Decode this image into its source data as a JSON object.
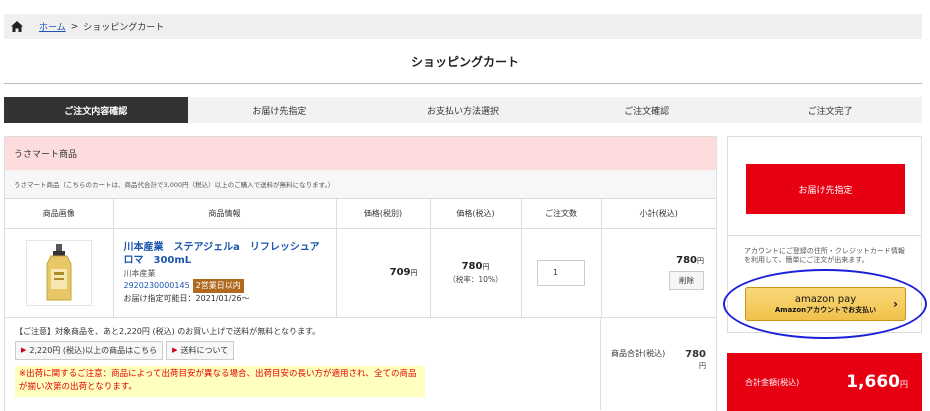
{
  "breadcrumb": {
    "home": "ホーム",
    "separator": ">",
    "current": "ショッピングカート"
  },
  "page": {
    "title": "ショッピングカート"
  },
  "steps": [
    "ご注文内容確認",
    "お届け先指定",
    "お支払い方法選択",
    "ご注文確認",
    "ご注文完了"
  ],
  "store": {
    "name": "うさマート商品",
    "note": "うさマート商品（こちらのカートは、商品代合計で3,000円（税込）以上のご購入で送料が無料になります。）"
  },
  "table": {
    "headers": [
      "商品画像",
      "商品情報",
      "価格(税別)",
      "価格(税込)",
      "ご注文数",
      "小計(税込)"
    ]
  },
  "item": {
    "name": "川本産業　ステアジェルa　リフレッシュアロマ　300mL",
    "maker": "川本産業",
    "code": "2920230000145",
    "shipping_badge": "2営業日以内",
    "delivery_date": "お届け指定可能日：2021/01/26～",
    "price_ex": "709",
    "price_in": "780",
    "tax_note": "（税率：10%）",
    "yen": "円",
    "quantity": "1",
    "subtotal": "780",
    "delete_label": "削除"
  },
  "notice": {
    "text": "【ご注意】対象商品を、あと2,220円 (税込) のお買い上げで送料が無料となります。",
    "btn_more": "2,220円 (税込)以上の商品はこちら",
    "btn_shipping": "送料について",
    "warning": "※出荷に関するご注意：商品によって出荷目安が異なる場合、出荷目安の長い方が適用され、全ての商品が揃い次第の出荷となります。"
  },
  "store_total": {
    "label": "商品合計(税込)",
    "value": "780",
    "yen": "円"
  },
  "side": {
    "proceed": "お届け先指定",
    "amazon_note": "アカウントにご登録の住所・クレジットカード情報を利用して、簡単にご注文が出来ます。",
    "amazon_logo": "amazon pay",
    "amazon_sub": "Amazonアカウントでお支払い"
  },
  "grand_total": {
    "label": "合計金額(税込)",
    "value": "1,660",
    "yen": "円"
  },
  "colors": {
    "accent_red": "#e60012",
    "link_blue": "#1a55b0",
    "store_header": "#fcdcdc",
    "badge_brown": "#b06a1f",
    "amazon_yellow": "#f0c14b"
  }
}
